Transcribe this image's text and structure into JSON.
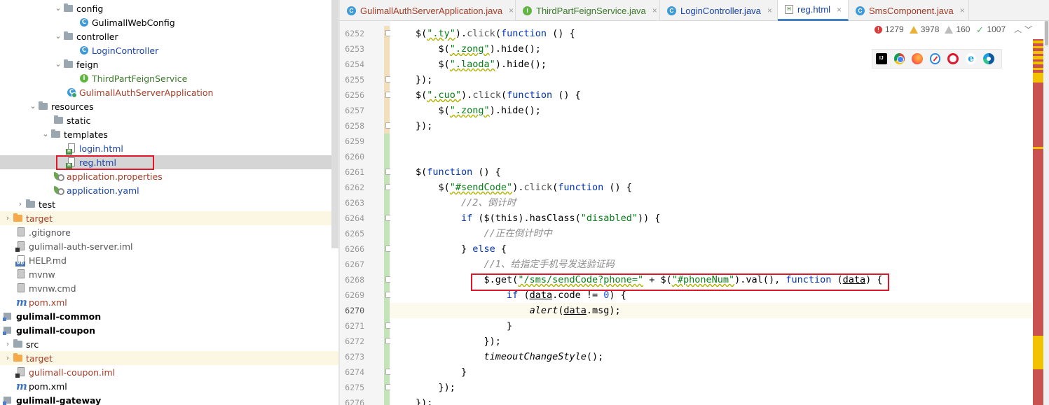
{
  "project_tree": {
    "items": [
      {
        "label": "config",
        "type": "folder"
      },
      {
        "label": "GulimallWebConfig",
        "type": "class"
      },
      {
        "label": "controller",
        "type": "folder"
      },
      {
        "label": "LoginController",
        "type": "class"
      },
      {
        "label": "feign",
        "type": "folder"
      },
      {
        "label": "ThirdPartFeignService",
        "type": "interface"
      },
      {
        "label": "GulimallAuthServerApplication",
        "type": "spring-class"
      },
      {
        "label": "resources",
        "type": "folder"
      },
      {
        "label": "static",
        "type": "folder"
      },
      {
        "label": "templates",
        "type": "folder"
      },
      {
        "label": "login.html",
        "type": "html"
      },
      {
        "label": "reg.html",
        "type": "html",
        "selected": true
      },
      {
        "label": "application.properties",
        "type": "properties"
      },
      {
        "label": "application.yaml",
        "type": "yaml"
      },
      {
        "label": "test",
        "type": "folder"
      },
      {
        "label": "target",
        "type": "excluded-folder"
      },
      {
        "label": ".gitignore",
        "type": "file"
      },
      {
        "label": "gulimall-auth-server.iml",
        "type": "iml"
      },
      {
        "label": "HELP.md",
        "type": "md"
      },
      {
        "label": "mvnw",
        "type": "file"
      },
      {
        "label": "mvnw.cmd",
        "type": "file"
      },
      {
        "label": "pom.xml",
        "type": "maven"
      },
      {
        "label": "gulimall-common",
        "type": "module"
      },
      {
        "label": "gulimall-coupon",
        "type": "module"
      },
      {
        "label": "src",
        "type": "folder"
      },
      {
        "label": "target",
        "type": "excluded-folder"
      },
      {
        "label": "gulimall-coupon.iml",
        "type": "iml"
      },
      {
        "label": "pom.xml",
        "type": "maven"
      },
      {
        "label": "gulimall-gateway",
        "type": "module"
      }
    ]
  },
  "editor_tabs": [
    {
      "label": "GulimallAuthServerApplication.java",
      "icon": "class-icon"
    },
    {
      "label": "ThirdPartFeignService.java",
      "icon": "interface-icon"
    },
    {
      "label": "LoginController.java",
      "icon": "class-icon"
    },
    {
      "label": "reg.html",
      "icon": "html-icon",
      "active": true
    },
    {
      "label": "SmsComponent.java",
      "icon": "class-icon"
    }
  ],
  "tab_close_glyph": "×",
  "inspections": {
    "errors": "1279",
    "warnings": "3978",
    "weak_warnings": "160",
    "typos": "1007"
  },
  "browser_icons": [
    "intellij-icon",
    "chrome-icon",
    "firefox-icon",
    "safari-icon",
    "opera-icon",
    "ie-icon",
    "edge-icon"
  ],
  "editor": {
    "current_line": "6270",
    "line_numbers": [
      "6252",
      "6253",
      "6254",
      "6255",
      "6256",
      "6257",
      "6258",
      "6259",
      "6260",
      "6261",
      "6262",
      "6263",
      "6264",
      "6265",
      "6266",
      "6267",
      "6268",
      "6269",
      "6270",
      "6271",
      "6272",
      "6273",
      "6274",
      "6275",
      "6276"
    ],
    "code_lines": [
      "$(\".ty\").click(function () {",
      "    $(\".zong\").hide();",
      "    $(\".laoda\").hide();",
      "});",
      "$(\".cuo\").click(function () {",
      "    $(\".zong\").hide();",
      "});",
      "",
      "",
      "$(function () {",
      "    $(\"#sendCode\").click(function () {",
      "        //2、倒计时",
      "        if ($(this).hasClass(\"disabled\")) {",
      "            //正在倒计时中",
      "        } else {",
      "            //1、给指定手机号发送验证码",
      "            $.get(\"/sms/sendCode?phone=\" + $(\"#phoneNum\").val(), function (data) {",
      "                if (data.code != 0) {",
      "                    alert(data.msg);",
      "                }",
      "            });",
      "            timeoutChangeStyle();",
      "        }",
      "    });",
      "});"
    ]
  },
  "colors": {
    "highlight_box": "#e0162b",
    "error_stripe": "#c9514f",
    "warning_stripe": "#f2c200",
    "current_line_bg": "#fcfaed",
    "selected_row_bg": "#d5d5d5"
  }
}
